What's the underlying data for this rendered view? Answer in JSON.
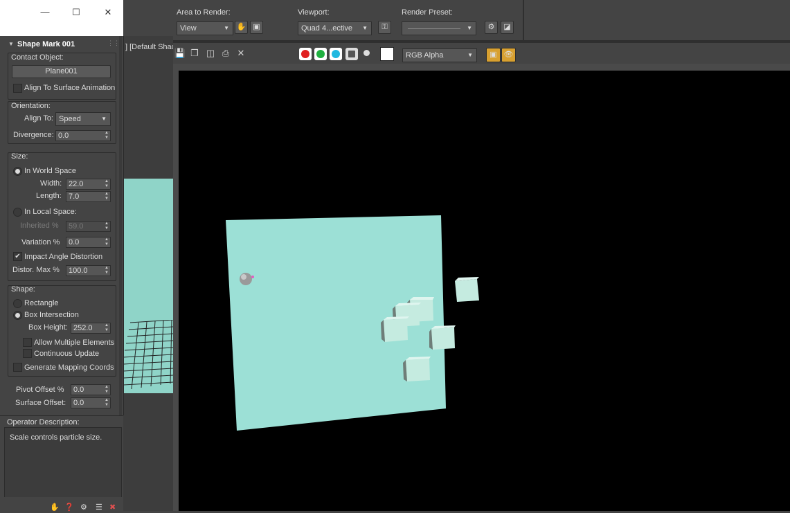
{
  "panel": {
    "rollout_title": "Shape Mark 001",
    "contact_object": {
      "label": "Contact Object:",
      "button": "Plane001",
      "align_checkbox": "Align To Surface Animation"
    },
    "orientation": {
      "label": "Orientation:",
      "align_to_label": "Align To:",
      "align_to_value": "Speed",
      "divergence_label": "Divergence:",
      "divergence_value": "0.0"
    },
    "size": {
      "label": "Size:",
      "world_space": "In World Space",
      "width_label": "Width:",
      "width_value": "22.0",
      "length_label": "Length:",
      "length_value": "7.0",
      "local_space": "In Local Space:",
      "inherited_label": "Inherited %",
      "inherited_value": "59.0",
      "variation_label": "Variation %",
      "variation_value": "0.0",
      "impact_label": "Impact Angle Distortion",
      "distor_label": "Distor. Max %",
      "distor_value": "100.0"
    },
    "shape": {
      "label": "Shape:",
      "rectangle": "Rectangle",
      "box_intersection": "Box Intersection",
      "box_height_label": "Box Height:",
      "box_height_value": "252.0",
      "allow_multiple": "Allow Multiple Elements",
      "continuous_update": "Continuous Update",
      "generate_mapping": "Generate Mapping Coords"
    },
    "pivot_offset_label": "Pivot Offset %",
    "pivot_offset_value": "0.0",
    "surface_offset_label": "Surface Offset:",
    "surface_offset_value": "0.0"
  },
  "description": {
    "title": "Operator Description:",
    "text": "Scale controls particle size."
  },
  "viewport_label": "] [Default Shac",
  "render": {
    "area_label": "Area to Render:",
    "area_value": "View",
    "viewport_label": "Viewport:",
    "viewport_value": "Quad 4...ective",
    "preset_label": "Render Preset:",
    "preset_value": "",
    "channel_value": "RGB Alpha"
  },
  "colors": {
    "plane": "#9ce0d6",
    "cube": "#c5ebe0",
    "cube_side": "#6f7d78",
    "red": "#e02020",
    "green": "#20b040",
    "blue": "#20b8e0"
  }
}
